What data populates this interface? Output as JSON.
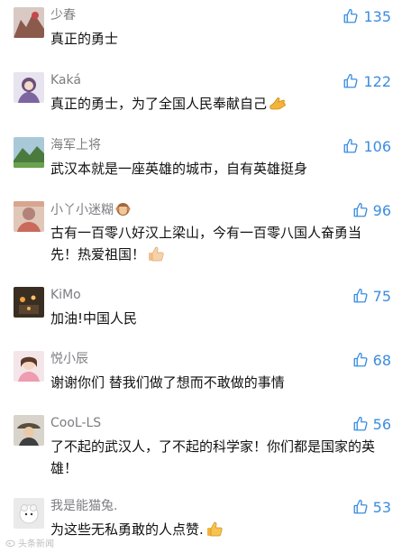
{
  "comments": [
    {
      "username": "少春",
      "text": "真正的勇士",
      "likes": "135"
    },
    {
      "username": "Kaká",
      "text": "真正的勇士，为了全国人民奉献自己",
      "likes": "122"
    },
    {
      "username": "海军上将",
      "text": "武汉本就是一座英雄的城市，自有英雄挺身",
      "likes": "106"
    },
    {
      "username": "小丫小迷糊",
      "text": "古有一百零八好汉上梁山，今有一百零八国人奋勇当先！热爱祖国！",
      "likes": "96"
    },
    {
      "username": "KiMo",
      "text": "加油!中国人民",
      "likes": "75"
    },
    {
      "username": "悦小辰",
      "text": "谢谢你们 替我们做了想而不敢做的事情",
      "likes": "68"
    },
    {
      "username": "CooL-LS",
      "text": "了不起的武汉人，了不起的科学家！你们都是国家的英雄！",
      "likes": "56"
    },
    {
      "username": "我是能猫兔.",
      "text": "为这些无私勇敢的人点赞.",
      "likes": "53"
    }
  ],
  "watermark": "头条新闻",
  "colors": {
    "like": "#3b8ddf",
    "username": "#7d7d82",
    "text": "#111111"
  }
}
